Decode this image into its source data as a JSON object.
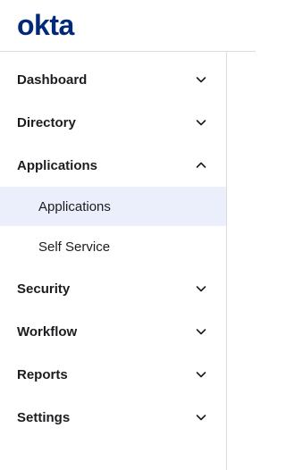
{
  "brand": {
    "logo_text": "okta",
    "logo_color": "#00297a"
  },
  "sidebar": {
    "items": [
      {
        "label": "Dashboard",
        "icon": "chevron-down-icon",
        "expanded": false
      },
      {
        "label": "Directory",
        "icon": "chevron-down-icon",
        "expanded": false
      },
      {
        "label": "Applications",
        "icon": "chevron-up-icon",
        "expanded": true,
        "children": [
          {
            "label": "Applications",
            "active": true
          },
          {
            "label": "Self Service",
            "active": false
          }
        ]
      },
      {
        "label": "Security",
        "icon": "chevron-down-icon",
        "expanded": false
      },
      {
        "label": "Workflow",
        "icon": "chevron-down-icon",
        "expanded": false
      },
      {
        "label": "Reports",
        "icon": "chevron-down-icon",
        "expanded": false
      },
      {
        "label": "Settings",
        "icon": "chevron-down-icon",
        "expanded": false
      }
    ],
    "active_background": "#ebeefb"
  }
}
